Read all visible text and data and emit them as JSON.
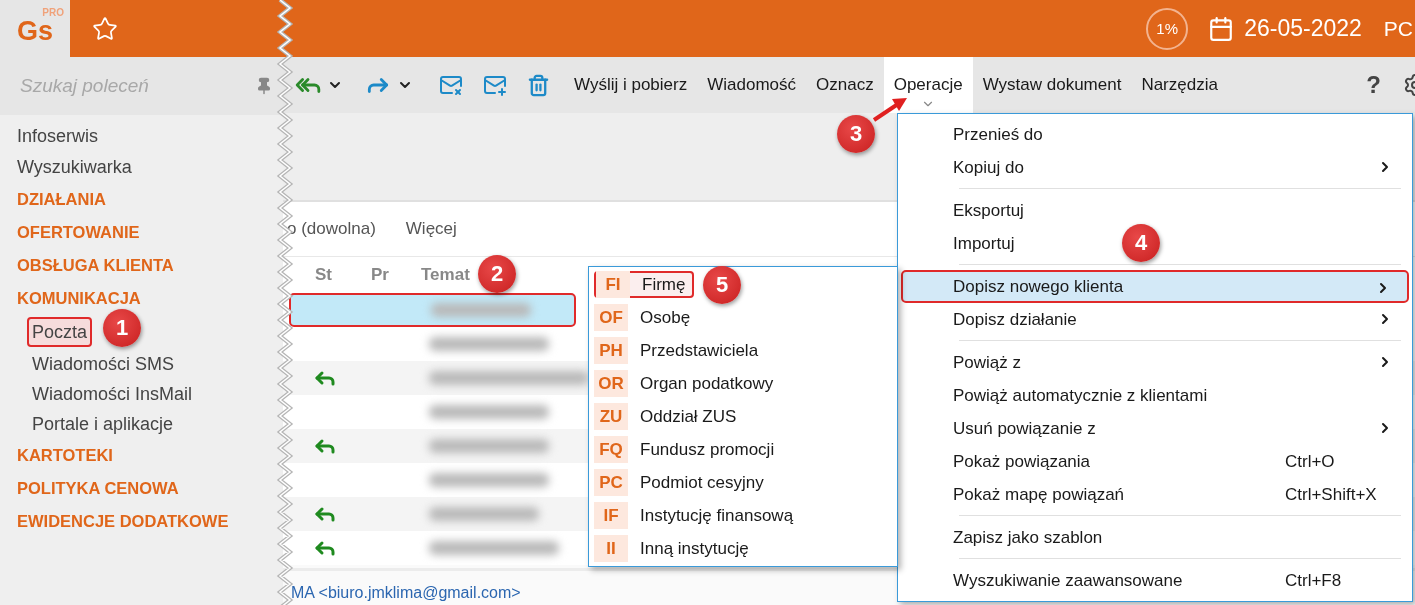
{
  "app": {
    "logo": "Gs",
    "edition": "PRO",
    "progress": "1%",
    "date": "26-05-2022",
    "user": "PC"
  },
  "command_search": {
    "placeholder": "Szukaj poleceń"
  },
  "sidebar": {
    "items": [
      {
        "label": "Infoserwis",
        "kind": "link",
        "selected": false
      },
      {
        "label": "Wyszukiwarka",
        "kind": "link",
        "selected": false
      },
      {
        "label": "DZIAŁANIA",
        "kind": "category",
        "selected": false
      },
      {
        "label": "OFERTOWANIE",
        "kind": "category",
        "selected": false
      },
      {
        "label": "OBSŁUGA KLIENTA",
        "kind": "category",
        "selected": false
      },
      {
        "label": "KOMUNIKACJA",
        "kind": "category",
        "selected": false
      },
      {
        "label": "Poczta",
        "kind": "subitem",
        "selected": true
      },
      {
        "label": "Wiadomości SMS",
        "kind": "subitem",
        "selected": false
      },
      {
        "label": "Wiadomości InsMail",
        "kind": "subitem",
        "selected": false
      },
      {
        "label": "Portale i aplikacje",
        "kind": "subitem",
        "selected": false
      },
      {
        "label": "KARTOTEKI",
        "kind": "category",
        "selected": false
      },
      {
        "label": "POLITYKA CENOWA",
        "kind": "category",
        "selected": false
      },
      {
        "label": "EWIDENCJE DODATKOWE",
        "kind": "category",
        "selected": false
      }
    ]
  },
  "toolbar": {
    "menus": [
      {
        "label": "Wyślij i pobierz",
        "selected": false
      },
      {
        "label": "Wiadomość",
        "selected": false
      },
      {
        "label": "Oznacz",
        "selected": false
      },
      {
        "label": "Operacje",
        "selected": true
      },
      {
        "label": "Wystaw dokument",
        "selected": false
      },
      {
        "label": "Narzędzia",
        "selected": false
      }
    ],
    "help": "?"
  },
  "filter_bar": {
    "items": [
      "o (dowolna)",
      "Więcej"
    ]
  },
  "table": {
    "columns": [
      "St",
      "Pr",
      "Temat"
    ],
    "rows": [
      {
        "replied": false,
        "selected": true
      },
      {
        "replied": false,
        "selected": false
      },
      {
        "replied": true,
        "selected": false
      },
      {
        "replied": false,
        "selected": false
      },
      {
        "replied": true,
        "selected": false
      },
      {
        "replied": false,
        "selected": false
      },
      {
        "replied": true,
        "selected": false
      },
      {
        "replied": true,
        "selected": false
      }
    ]
  },
  "footer": {
    "sender": "MA <biuro.jmklima@gmail.com>"
  },
  "operations_menu": {
    "groups": [
      {
        "items": [
          {
            "label": "Przenieś do",
            "submenu": false,
            "selected": false
          },
          {
            "label": "Kopiuj do",
            "submenu": true,
            "selected": false
          }
        ]
      },
      {
        "items": [
          {
            "label": "Eksportuj",
            "submenu": false,
            "selected": false
          },
          {
            "label": "Importuj",
            "submenu": false,
            "selected": false
          }
        ]
      },
      {
        "items": [
          {
            "label": "Dopisz nowego klienta",
            "submenu": true,
            "selected": true
          },
          {
            "label": "Dopisz działanie",
            "submenu": true,
            "selected": false
          }
        ]
      },
      {
        "items": [
          {
            "label": "Powiąż z",
            "submenu": true,
            "selected": false
          },
          {
            "label": "Powiąż automatycznie z klientami",
            "submenu": false,
            "selected": false
          },
          {
            "label": "Usuń powiązanie z",
            "submenu": true,
            "selected": false
          },
          {
            "label": "Pokaż powiązania",
            "shortcut": "Ctrl+O",
            "submenu": false,
            "selected": false
          },
          {
            "label": "Pokaż mapę powiązań",
            "shortcut": "Ctrl+Shift+X",
            "submenu": false,
            "selected": false
          }
        ]
      },
      {
        "items": [
          {
            "label": "Zapisz jako szablon",
            "submenu": false,
            "selected": false
          }
        ]
      },
      {
        "items": [
          {
            "label": "Wyszukiwanie zaawansowane",
            "shortcut": "Ctrl+F8",
            "submenu": false,
            "selected": false
          }
        ]
      }
    ]
  },
  "client_submenu": {
    "items": [
      {
        "code": "FI",
        "label": "Firmę",
        "selected": true
      },
      {
        "code": "OF",
        "label": "Osobę",
        "selected": false
      },
      {
        "code": "PH",
        "label": "Przedstawiciela",
        "selected": false
      },
      {
        "code": "OR",
        "label": "Organ podatkowy",
        "selected": false
      },
      {
        "code": "ZU",
        "label": "Oddział ZUS",
        "selected": false
      },
      {
        "code": "FQ",
        "label": "Fundusz promocji",
        "selected": false
      },
      {
        "code": "PC",
        "label": "Podmiot cesyjny",
        "selected": false
      },
      {
        "code": "IF",
        "label": "Instytucję finansową",
        "selected": false
      },
      {
        "code": "II",
        "label": "Inną instytucję",
        "selected": false
      }
    ]
  },
  "callouts": [
    "1",
    "2",
    "3",
    "4",
    "5"
  ]
}
